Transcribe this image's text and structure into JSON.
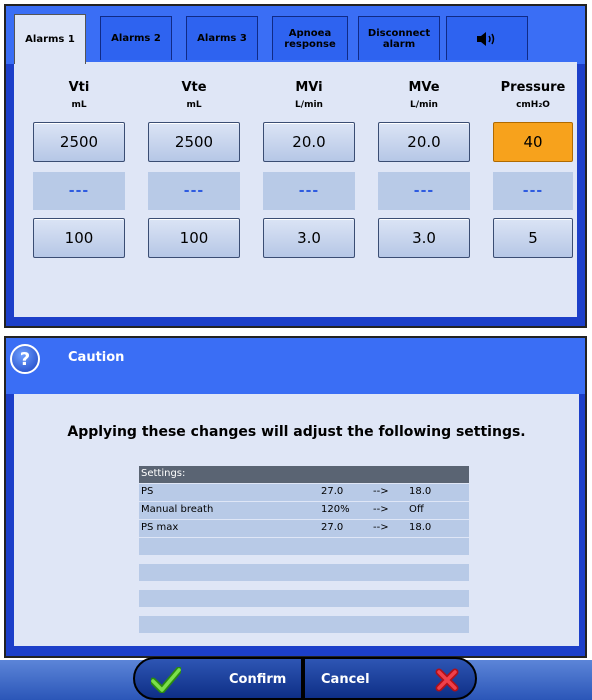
{
  "tabs": [
    {
      "label": "Alarms 1",
      "active": true
    },
    {
      "label": "Alarms 2",
      "active": false
    },
    {
      "label": "Alarms 3",
      "active": false
    },
    {
      "label": "Apnoea response",
      "active": false
    },
    {
      "label": "Disconnect alarm",
      "active": false
    },
    {
      "icon": "speaker-icon",
      "active": false
    }
  ],
  "columns": [
    {
      "name": "Vti",
      "unit": "mL",
      "high": "2500",
      "mid": "---",
      "low": "100",
      "highlighted": false
    },
    {
      "name": "Vte",
      "unit": "mL",
      "high": "2500",
      "mid": "---",
      "low": "100",
      "highlighted": false
    },
    {
      "name": "MVi",
      "unit": "L/min",
      "high": "20.0",
      "mid": "---",
      "low": "3.0",
      "highlighted": false
    },
    {
      "name": "MVe",
      "unit": "L/min",
      "high": "20.0",
      "mid": "---",
      "low": "3.0",
      "highlighted": false
    },
    {
      "name": "Pressure",
      "unit": "cmH₂O",
      "high": "40",
      "mid": "---",
      "low": "5",
      "highlighted": true
    }
  ],
  "dialog": {
    "icon": "help-icon",
    "title": "Caution",
    "message": "Applying these changes will adjust the following settings.",
    "table_header": "Settings:",
    "rows": [
      {
        "name": "PS",
        "old": "27.0",
        "arrow": "-->",
        "new": "18.0"
      },
      {
        "name": "Manual breath",
        "old": "120%",
        "arrow": "-->",
        "new": "Off"
      },
      {
        "name": "PS max",
        "old": "27.0",
        "arrow": "-->",
        "new": "18.0"
      }
    ]
  },
  "buttons": {
    "confirm_label": "Confirm",
    "cancel_label": "Cancel"
  },
  "colors": {
    "frame_blue": "#1c3fc9",
    "tab_blue": "#3a6ef5",
    "panel_bg": "#dfe6f6",
    "highlight_orange": "#f7a21c"
  }
}
